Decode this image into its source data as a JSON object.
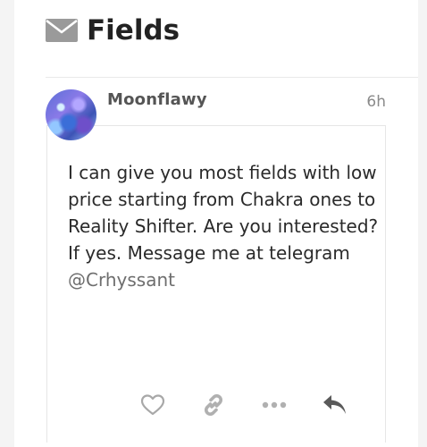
{
  "topic": {
    "icon": "envelope-icon",
    "title": "Fields"
  },
  "post": {
    "username": "Moonflawy",
    "age": "6h",
    "avatar_icon": "user-avatar",
    "body_lines": {
      "paragraph1": "I can give you most fields with low price starting from Chakra ones to Reality Shifter. Are you interested?",
      "paragraph2_prefix": "If yes. Message me at telegram",
      "mention": "@Crhyssant"
    }
  },
  "actions": {
    "like_icon": "heart-icon",
    "link_icon": "link-icon",
    "more_icon": "ellipsis-icon",
    "reply_icon": "reply-icon"
  },
  "colors": {
    "title": "#222222",
    "username": "#555555",
    "muted": "#8a8a8a",
    "icon": "#b0b0b0",
    "reply_icon": "#555555",
    "background": "#f4f4f4",
    "panel": "#ffffff"
  }
}
